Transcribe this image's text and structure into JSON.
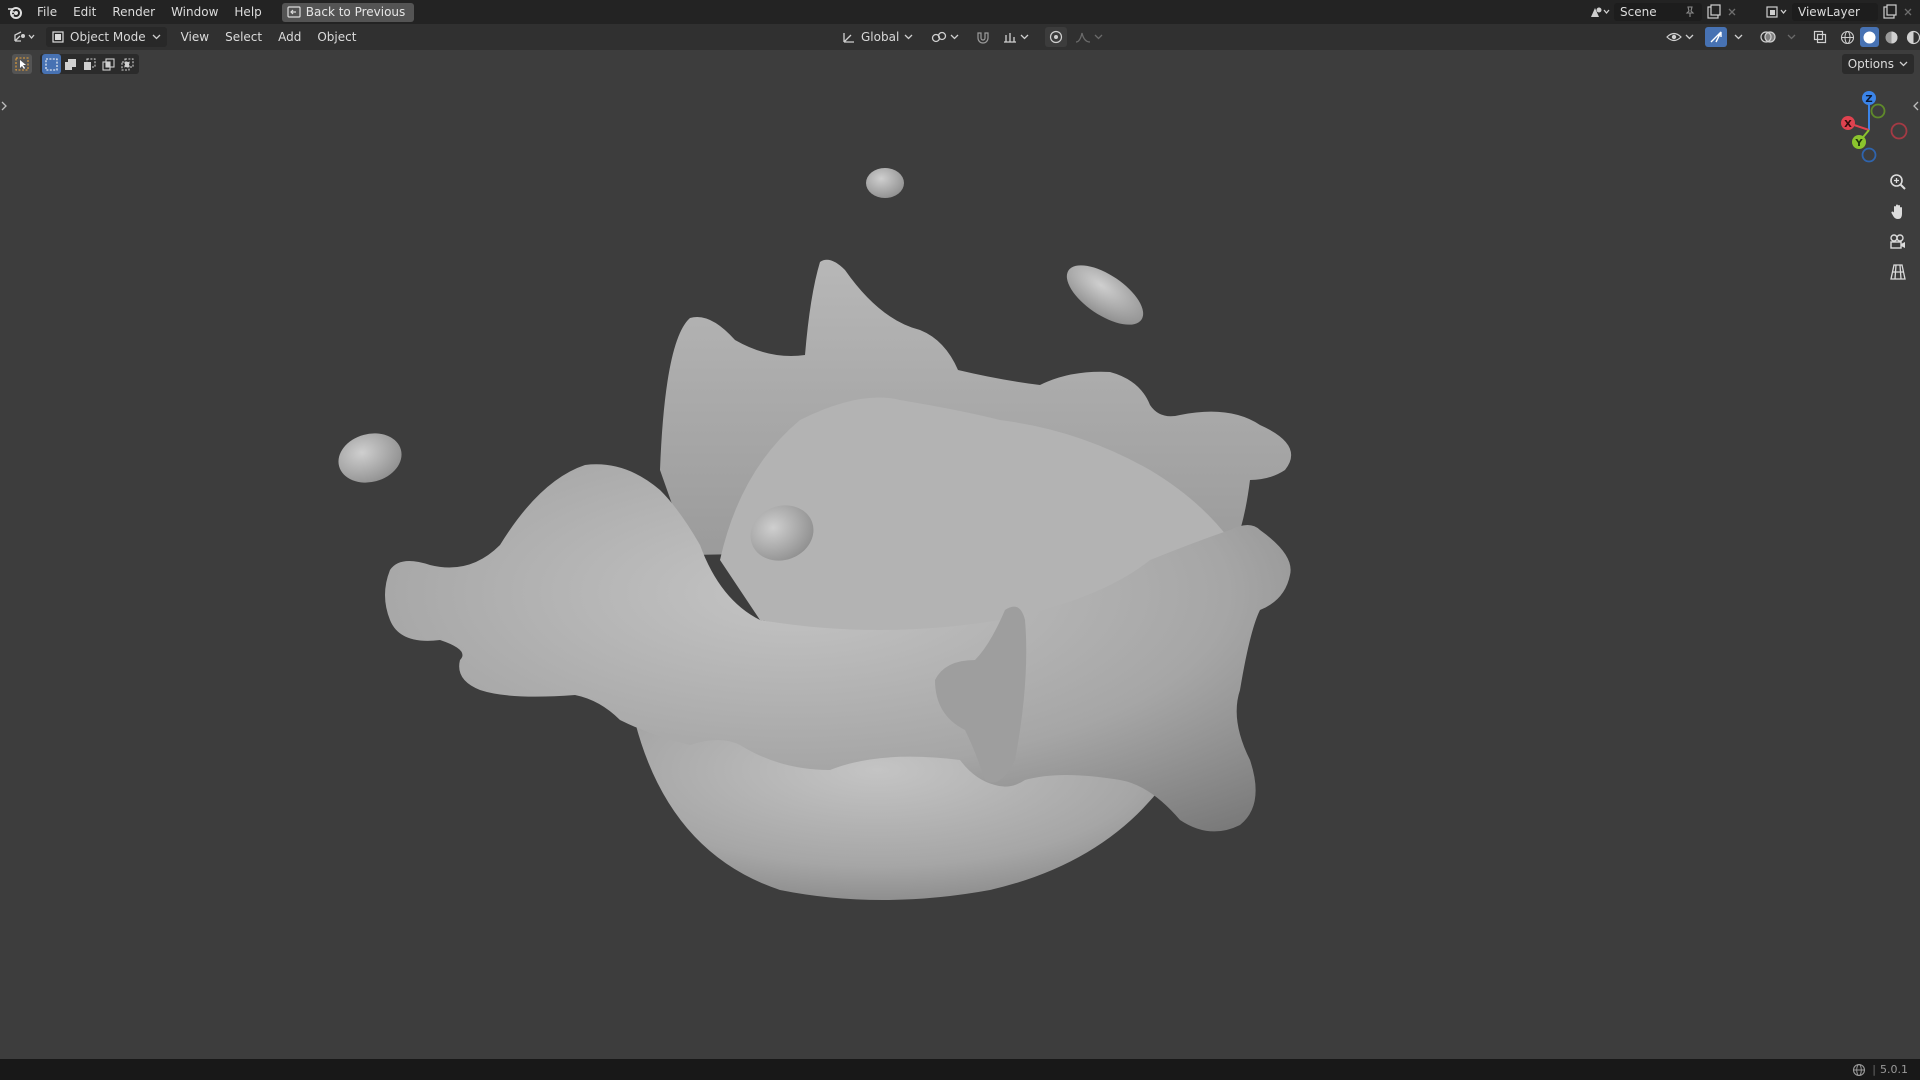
{
  "menu": {
    "file": "File",
    "edit": "Edit",
    "render": "Render",
    "window": "Window",
    "help": "Help",
    "back": "Back to Previous"
  },
  "scene": {
    "name": "Scene"
  },
  "view_layer": {
    "name": "ViewLayer"
  },
  "header": {
    "mode": "Object Mode",
    "view": "View",
    "select": "Select",
    "add": "Add",
    "object": "Object",
    "orientation": "Global"
  },
  "viewport": {
    "options": "Options"
  },
  "gizmo": {
    "x": "X",
    "y": "Y",
    "z": "Z"
  },
  "status": {
    "version": "5.0.1"
  },
  "colors": {
    "accent": "#4772b3",
    "x_axis": "#e0424f",
    "y_axis": "#8bc42d",
    "z_axis": "#3b84e8",
    "mesh": "#a8a8a8",
    "background": "#3d3d3d"
  }
}
